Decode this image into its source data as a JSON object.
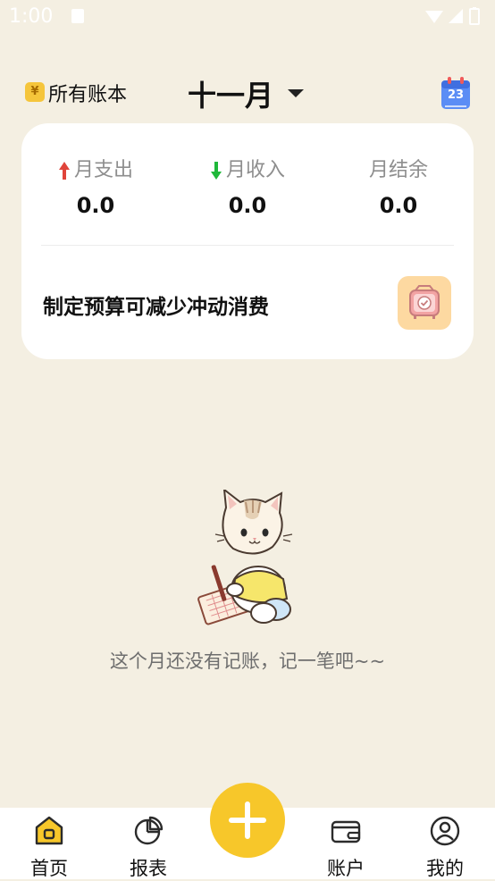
{
  "status_bar": {
    "time": "1:00"
  },
  "header": {
    "book_icon_symbol": "¥",
    "book_label": "所有账本",
    "month": "十一月",
    "calendar_day": "23"
  },
  "summary": {
    "expense": {
      "label": "月支出",
      "value": "0.0",
      "arrow_color": "#e0443a"
    },
    "income": {
      "label": "月收入",
      "value": "0.0",
      "arrow_color": "#1fb83a"
    },
    "balance": {
      "label": "月结余",
      "value": "0.0"
    },
    "budget_tip": "制定预算可减少冲动消费"
  },
  "empty_state": {
    "message": "这个月还没有记账，记一笔吧~~"
  },
  "bottom_nav": {
    "items": [
      {
        "label": "首页",
        "icon": "home-icon",
        "active": true
      },
      {
        "label": "报表",
        "icon": "pie-chart-icon"
      },
      {
        "label": "账户",
        "icon": "wallet-icon"
      },
      {
        "label": "我的",
        "icon": "user-icon"
      }
    ],
    "fab_icon": "plus-icon"
  },
  "colors": {
    "accent": "#f7c72a",
    "background": "#f4efe2"
  }
}
